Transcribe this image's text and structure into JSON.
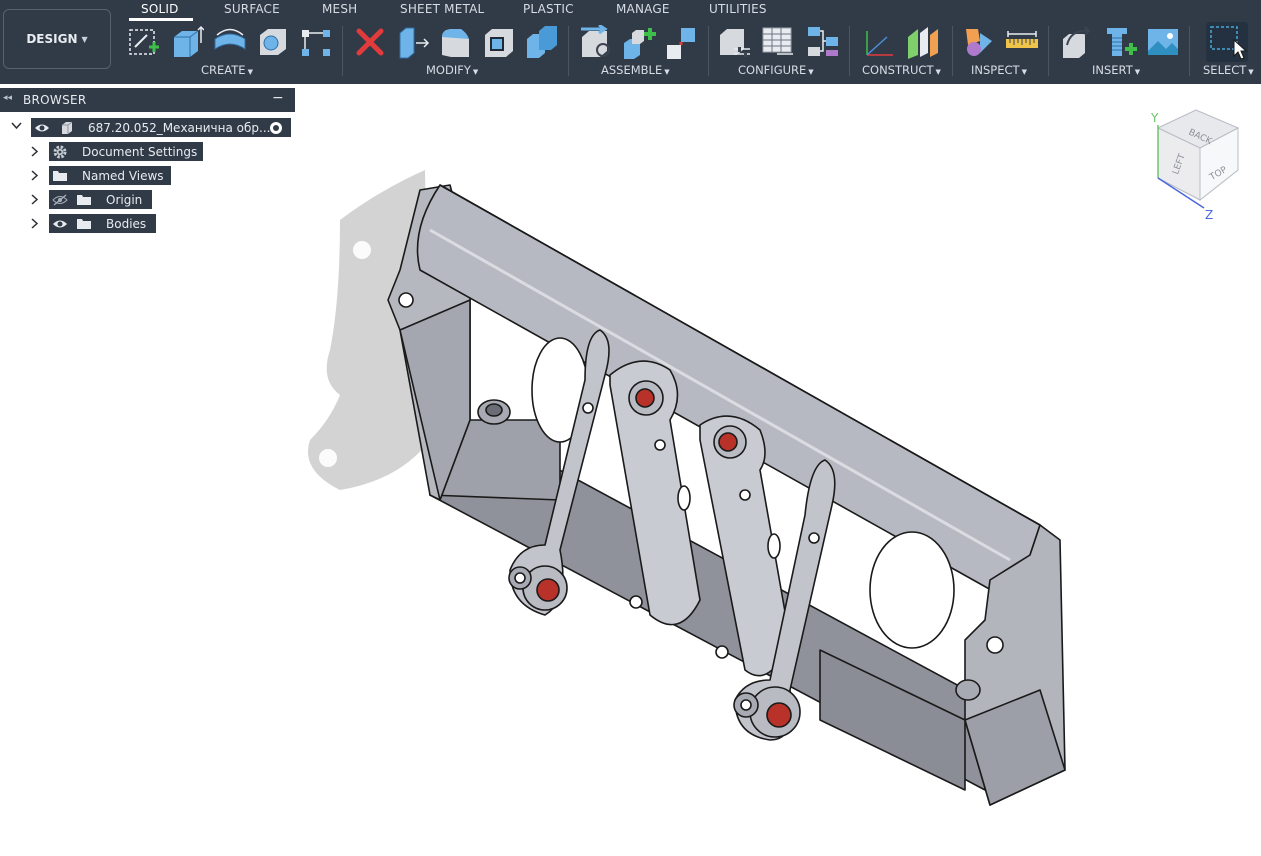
{
  "workspace": {
    "label": "DESIGN"
  },
  "tabs": [
    {
      "label": "SOLID",
      "active": true
    },
    {
      "label": "SURFACE"
    },
    {
      "label": "MESH"
    },
    {
      "label": "SHEET METAL"
    },
    {
      "label": "PLASTIC"
    },
    {
      "label": "MANAGE"
    },
    {
      "label": "UTILITIES"
    }
  ],
  "groups": {
    "create": "CREATE",
    "modify": "MODIFY",
    "assemble": "ASSEMBLE",
    "configure": "CONFIGURE",
    "construct": "CONSTRUCT",
    "inspect": "INSPECT",
    "insert": "INSERT",
    "select": "SELECT"
  },
  "browser": {
    "title": "BROWSER",
    "root": "687.20.052_Механична обр...",
    "items": [
      {
        "label": "Document Settings",
        "icon": "gear-icon"
      },
      {
        "label": "Named Views",
        "icon": "folder-icon"
      },
      {
        "label": "Origin",
        "icon": "folder-icon",
        "visibility": "hidden"
      },
      {
        "label": "Bodies",
        "icon": "folder-icon",
        "visibility": "visible"
      }
    ]
  },
  "viewcube": {
    "faces": {
      "top": "TOP",
      "left": "LEFT",
      "back": "BACK"
    },
    "axes": {
      "y": "Y",
      "z": "Z"
    }
  },
  "colors": {
    "toolbar": "#313a47",
    "accent": "#4a90d9",
    "body": "#c7c9d0",
    "bore": "#b8322a"
  }
}
